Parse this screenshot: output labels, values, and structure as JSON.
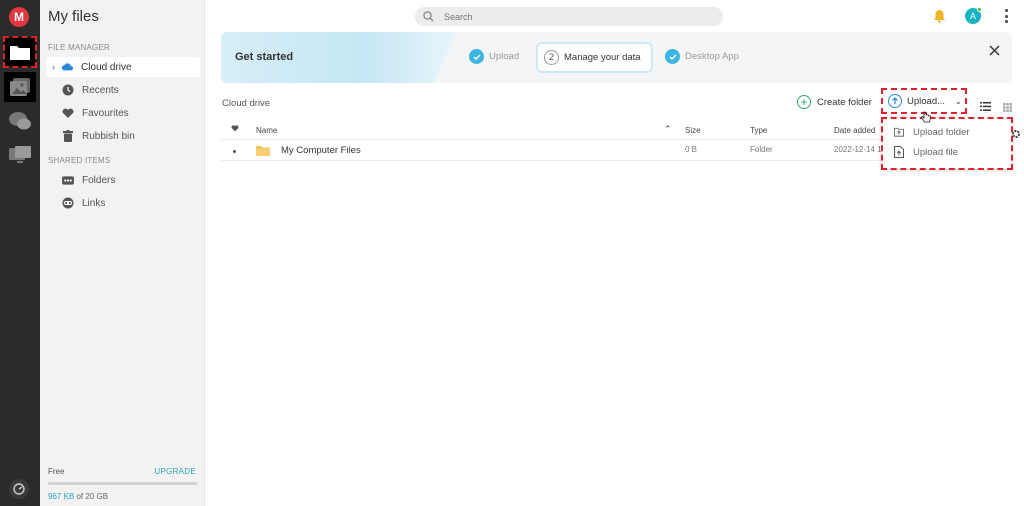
{
  "rail": {
    "logo_letter": "M",
    "items": [
      {
        "name": "cloud-drive",
        "icon": "folder-icon",
        "active": true
      },
      {
        "name": "photos",
        "icon": "image-icon",
        "active": false
      },
      {
        "name": "chat",
        "icon": "chat-icon",
        "active": false
      },
      {
        "name": "backups",
        "icon": "monitor-icon",
        "active": false
      }
    ]
  },
  "sidebar": {
    "title": "My files",
    "file_manager_label": "FILE MANAGER",
    "shared_label": "SHARED ITEMS",
    "items": [
      {
        "label": "Cloud drive",
        "icon": "cloud-icon",
        "active": true
      },
      {
        "label": "Recents",
        "icon": "clock-icon"
      },
      {
        "label": "Favourites",
        "icon": "heart-icon"
      },
      {
        "label": "Rubbish bin",
        "icon": "trash-icon"
      }
    ],
    "shared_items": [
      {
        "label": "Folders",
        "icon": "shared-folders-icon"
      },
      {
        "label": "Links",
        "icon": "link-icon"
      }
    ],
    "plan": "Free",
    "upgrade": "UPGRADE",
    "used": "967 KB",
    "usage_suffix": " of 20 GB",
    "usage_fraction": 5e-05
  },
  "search": {
    "placeholder": "Search"
  },
  "banner": {
    "title": "Get started",
    "steps": [
      {
        "label": "Upload",
        "state": "done"
      },
      {
        "label": "Manage your data",
        "state": "current",
        "number": "2"
      },
      {
        "label": "Desktop App",
        "state": "done"
      }
    ]
  },
  "toolbar": {
    "breadcrumb": "Cloud drive",
    "create_folder": "Create folder",
    "upload": "Upload..."
  },
  "table": {
    "headers": {
      "name": "Name",
      "size": "Size",
      "type": "Type",
      "date": "Date added"
    },
    "rows": [
      {
        "name": "My Computer Files",
        "size": "0 B",
        "type": "Folder",
        "date": "2022-12-14 1"
      }
    ]
  },
  "upload_menu": {
    "items": [
      {
        "label": "Upload folder",
        "icon": "upload-folder-icon"
      },
      {
        "label": "Upload file",
        "icon": "upload-file-icon"
      }
    ]
  },
  "user": {
    "avatar_letter": "A"
  },
  "colors": {
    "accent": "#2ba6b3",
    "brand": "#e0383e",
    "highlight_dashed": "#e0202a",
    "step_check": "#3cb6e0"
  }
}
